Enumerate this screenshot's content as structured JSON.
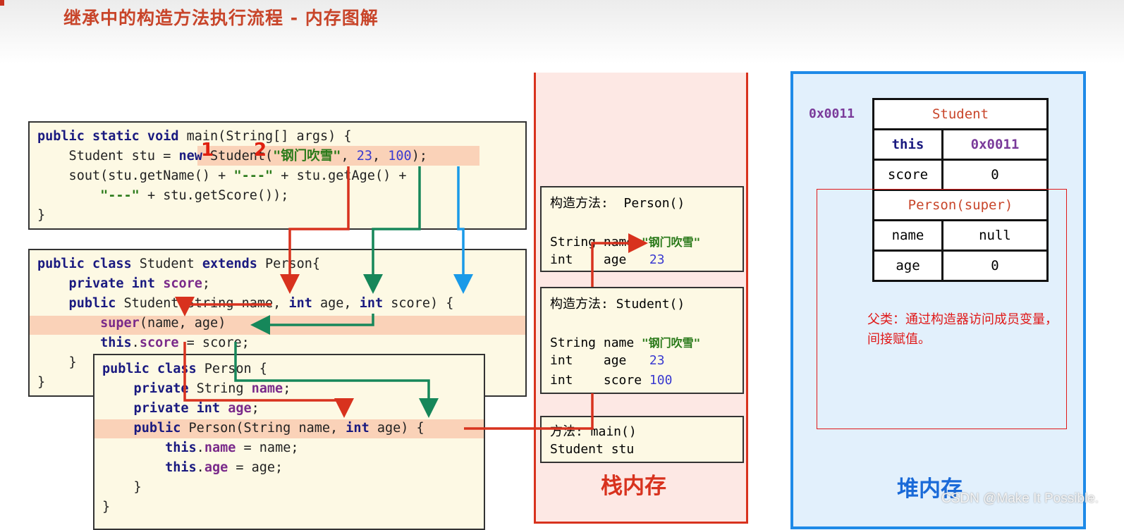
{
  "title": "继承中的构造方法执行流程 - 内存图解",
  "step_numbers": [
    "1",
    "2"
  ],
  "main_code": [
    [
      [
        "public static void ",
        "k"
      ],
      [
        "main(String[] args) {",
        "p"
      ]
    ],
    [
      [
        "    Student stu = ",
        "p"
      ],
      [
        "new ",
        "k"
      ],
      [
        "Student(",
        "p"
      ],
      [
        "\"钢门吹雪\"",
        "s"
      ],
      [
        ", ",
        "p"
      ],
      [
        "23",
        "n"
      ],
      [
        ", ",
        "p"
      ],
      [
        "100",
        "n"
      ],
      [
        ");",
        "p"
      ]
    ],
    [
      [
        "    sout(stu.getName() + ",
        "p"
      ],
      [
        "\"---\"",
        "s"
      ],
      [
        " + stu.getAge() +",
        "p"
      ]
    ],
    [
      [
        "        ",
        "p"
      ],
      [
        "\"---\"",
        "s"
      ],
      [
        " + stu.getScore());",
        "p"
      ]
    ],
    [
      [
        "}",
        "p"
      ]
    ]
  ],
  "student_code": [
    [
      [
        "public class ",
        "k"
      ],
      [
        "Student ",
        "p"
      ],
      [
        "extends ",
        "k"
      ],
      [
        "Person{",
        "p"
      ]
    ],
    [
      [
        "    private int ",
        "k"
      ],
      [
        "score",
        "f"
      ],
      [
        ";",
        "p"
      ]
    ],
    [
      [
        "    public ",
        "k"
      ],
      [
        "Student(String name, ",
        "p"
      ],
      [
        "int ",
        "k"
      ],
      [
        "age, ",
        "p"
      ],
      [
        "int ",
        "k"
      ],
      [
        "score) {",
        "p"
      ]
    ],
    [
      [
        "        ",
        "p"
      ],
      [
        "super",
        "f"
      ],
      [
        "(name, age)",
        "p"
      ]
    ],
    [
      [
        "        ",
        "p"
      ],
      [
        "this",
        "k"
      ],
      [
        ".",
        "p"
      ],
      [
        "score",
        "f"
      ],
      [
        " = score;",
        "p"
      ]
    ],
    [
      [
        "    }",
        "p"
      ]
    ],
    [
      [
        "}",
        "p"
      ]
    ]
  ],
  "person_code": [
    [
      [
        "public class ",
        "k"
      ],
      [
        "Person {",
        "p"
      ]
    ],
    [
      [
        "    private ",
        "k"
      ],
      [
        "String ",
        "p"
      ],
      [
        "name",
        "f"
      ],
      [
        ";",
        "p"
      ]
    ],
    [
      [
        "    private int ",
        "k"
      ],
      [
        "age",
        "f"
      ],
      [
        ";",
        "p"
      ]
    ],
    [
      [
        "    public ",
        "k"
      ],
      [
        "Person(String name, ",
        "p"
      ],
      [
        "int ",
        "k"
      ],
      [
        "age) {",
        "p"
      ]
    ],
    [
      [
        "        ",
        "p"
      ],
      [
        "this",
        "k"
      ],
      [
        ".",
        "p"
      ],
      [
        "name",
        "f"
      ],
      [
        " = name;",
        "p"
      ]
    ],
    [
      [
        "        ",
        "p"
      ],
      [
        "this",
        "k"
      ],
      [
        ".",
        "p"
      ],
      [
        "age",
        "f"
      ],
      [
        " = age;",
        "p"
      ]
    ],
    [
      [
        "    }",
        "p"
      ]
    ],
    [
      [
        "}",
        "p"
      ]
    ]
  ],
  "stack": {
    "label": "栈内存",
    "person_frame": {
      "header": "构造方法:  Person()",
      "name_decl": "String name ",
      "name_val": "\"钢门吹雪\"",
      "age_decl": "int    age   ",
      "age_val": "23"
    },
    "student_frame": {
      "header": "构造方法: Student()",
      "name_decl": "String name ",
      "name_val": "\"钢门吹雪\"",
      "age_decl": "int    age   ",
      "age_val": "23",
      "score_decl": "int    score ",
      "score_val": "100"
    },
    "main_frame": {
      "header": "方法: main()",
      "var": "Student stu"
    }
  },
  "heap": {
    "label": "堆内存",
    "address": "0x0011",
    "object": {
      "class_name": "Student",
      "this_label": "this",
      "this_value": "0x0011",
      "score_label": "score",
      "score_value": "0",
      "super_name": "Person(super)",
      "name_label": "name",
      "name_value": "null",
      "age_label": "age",
      "age_value": "0"
    },
    "note": "父类：通过构造器访问成员变量，间接赋值。"
  },
  "watermark": "CSDN @Make It Possible.",
  "colors": {
    "red": "#d8321e",
    "green": "#16875a",
    "blue": "#1a9ae8"
  }
}
